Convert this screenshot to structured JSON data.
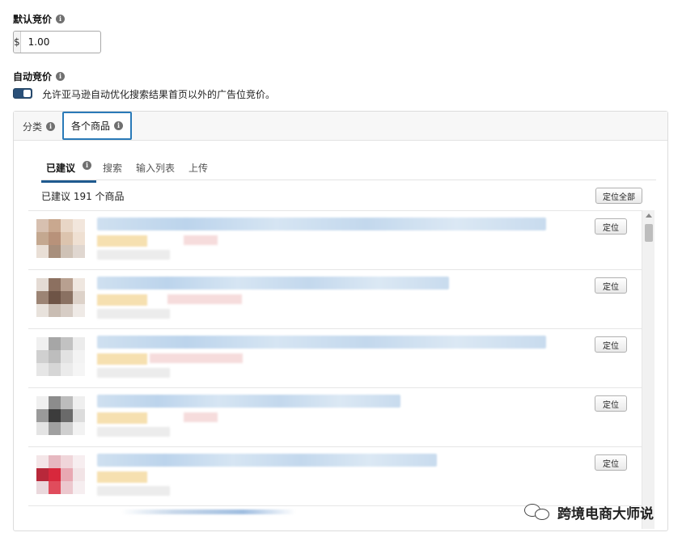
{
  "default_bid": {
    "label": "默认竞价",
    "currency": "$",
    "value": "1.00"
  },
  "auto_bid": {
    "label": "自动竞价",
    "toggle_on": true,
    "description": "允许亚马逊自动优化搜索结果首页以外的广告位竞价。"
  },
  "outer_tabs": [
    {
      "label": "分类",
      "active": false
    },
    {
      "label": "各个商品",
      "active": true
    }
  ],
  "inner_tabs": [
    {
      "label": "已建议",
      "active": true
    },
    {
      "label": "搜索",
      "active": false
    },
    {
      "label": "输入列表",
      "active": false
    },
    {
      "label": "上传",
      "active": false
    }
  ],
  "suggested": {
    "count_text": "已建议 191 个商品",
    "target_all_label": "定位全部"
  },
  "products": [
    {
      "target_label": "定位"
    },
    {
      "target_label": "定位"
    },
    {
      "target_label": "定位"
    },
    {
      "target_label": "定位"
    },
    {
      "target_label": "定位"
    }
  ],
  "watermark": {
    "text": "跨境电商大师说"
  },
  "colors": {
    "toggle": "#2a5078",
    "active_tab_border": "#2a7ab8",
    "inner_tab_underline": "#1f5a8f"
  }
}
